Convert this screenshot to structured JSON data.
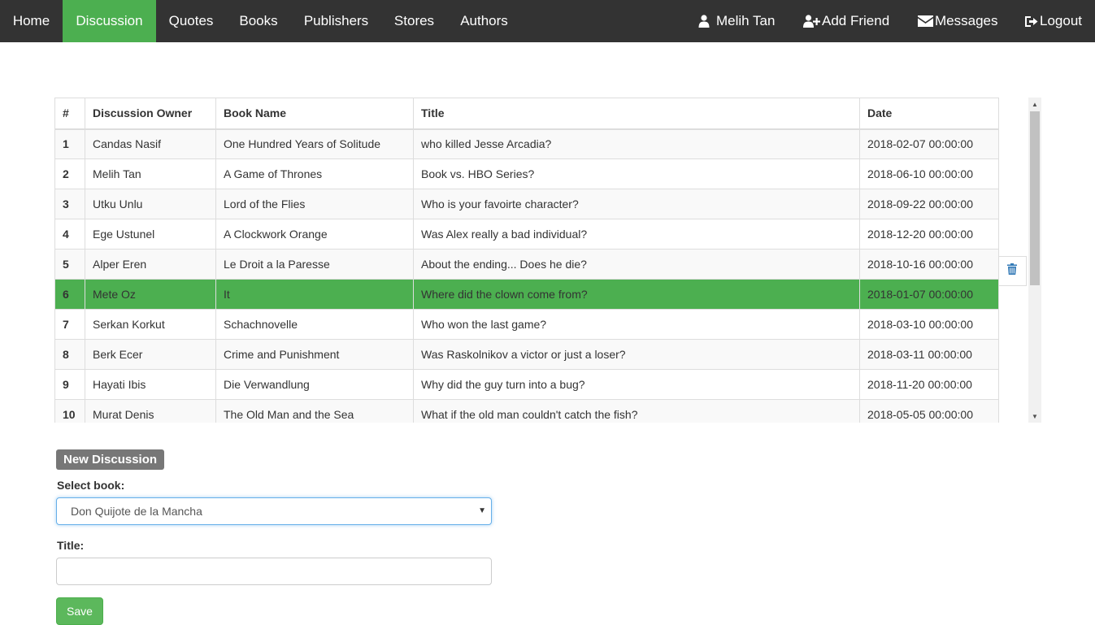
{
  "nav": {
    "home": "Home",
    "discussion": "Discussion",
    "quotes": "Quotes",
    "books": "Books",
    "publishers": "Publishers",
    "stores": "Stores",
    "authors": "Authors",
    "user": "Melih Tan",
    "add_friend": "Add Friend",
    "messages": "Messages",
    "logout": "Logout"
  },
  "table": {
    "headers": [
      "#",
      "Discussion Owner",
      "Book Name",
      "Title",
      "Date"
    ],
    "rows": [
      {
        "num": "1",
        "owner": "Candas Nasif",
        "book": "One Hundred Years of Solitude",
        "title": "who killed Jesse Arcadia?",
        "date": "2018-02-07 00:00:00"
      },
      {
        "num": "2",
        "owner": "Melih Tan",
        "book": "A Game of Thrones",
        "title": "Book vs. HBO Series?",
        "date": "2018-06-10 00:00:00"
      },
      {
        "num": "3",
        "owner": "Utku Unlu",
        "book": "Lord of the Flies",
        "title": "Who is your favoirte character?",
        "date": "2018-09-22 00:00:00"
      },
      {
        "num": "4",
        "owner": "Ege Ustunel",
        "book": "A Clockwork Orange",
        "title": "Was Alex really a bad individual?",
        "date": "2018-12-20 00:00:00"
      },
      {
        "num": "5",
        "owner": "Alper Eren",
        "book": "Le Droit a la Paresse",
        "title": "About the ending... Does he die?",
        "date": "2018-10-16 00:00:00"
      },
      {
        "num": "6",
        "owner": "Mete Oz",
        "book": "It",
        "title": "Where did the clown come from?",
        "date": "2018-01-07 00:00:00"
      },
      {
        "num": "7",
        "owner": "Serkan Korkut",
        "book": "Schachnovelle",
        "title": "Who won the last game?",
        "date": "2018-03-10 00:00:00"
      },
      {
        "num": "8",
        "owner": "Berk Ecer",
        "book": "Crime and Punishment",
        "title": "Was Raskolnikov a victor or just a loser?",
        "date": "2018-03-11 00:00:00"
      },
      {
        "num": "9",
        "owner": "Hayati Ibis",
        "book": "Die Verwandlung",
        "title": "Why did the guy turn into a bug?",
        "date": "2018-11-20 00:00:00"
      },
      {
        "num": "10",
        "owner": "Murat Denis",
        "book": "The Old Man and the Sea",
        "title": "What if the old man couldn't catch the fish?",
        "date": "2018-05-05 00:00:00"
      }
    ]
  },
  "form": {
    "badge": "New Discussion",
    "select_label": "Select book:",
    "selected_book": "Don Quijote de la Mancha",
    "title_label": "Title:",
    "title_value": "",
    "title_placeholder": "",
    "save_label": "Save"
  },
  "colors": {
    "navbar": "#333333",
    "active_nav": "#4caf50",
    "selected_row": "#4caf50",
    "save_button": "#5cb85c",
    "badge": "#777777",
    "trash_icon": "#337ab7"
  },
  "icons": {
    "user": "user-icon",
    "add_friend": "user-plus-icon",
    "messages": "envelope-icon",
    "logout": "logout-icon",
    "delete": "trash-icon"
  }
}
